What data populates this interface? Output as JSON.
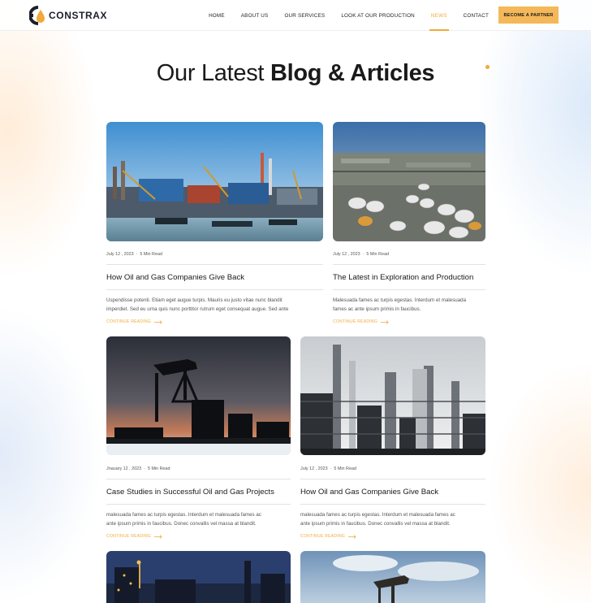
{
  "brand": {
    "name": "CONSTRAX"
  },
  "nav": {
    "items": [
      "HOME",
      "ABOUT US",
      "OUR SERVICES",
      "LOOK AT OUR PRODUCTION",
      "NEWS",
      "CONTACT"
    ],
    "active": "NEWS",
    "cta": "BECOME A PARTNER"
  },
  "section": {
    "title_light": "Our Latest",
    "title_bold": "Blog & Articles"
  },
  "posts": [
    {
      "date": "July 12 , 2023",
      "read_time": "5 Min Read",
      "title": "How Oil and Gas Companies Give Back",
      "excerpt_lines": [
        "Uspendisse potenti. Etiam eget augue turpis. Mauris eu justo vitae nunc blandit",
        "imperdiet. Sed eu urna quis nunc porttitor rutrum eget consequat augue. Sed ante"
      ],
      "link": "CONTINUE READING",
      "image": "industrial-port-image"
    },
    {
      "date": "July 12 , 2023",
      "read_time": "5 Min Read",
      "title": "The Latest in Exploration and Production",
      "excerpt_lines": [
        "Malesuada fames ac turpis egestas. Interdum et malesuada",
        "fames ac ante ipsum primis in faucibus."
      ],
      "link": "CONTINUE READING",
      "image": "oil-storage-tanks-image"
    },
    {
      "date": "Jnauary 12 , 2023",
      "read_time": "5 Min Read",
      "title": "Case Studies in Successful Oil and Gas Projects",
      "excerpt_lines": [
        "malesuada fames ac turpis egestas. Interdum et malesuada fames ac",
        "ante ipsum primis in faucibus. Donec convallis vel massa at blandit."
      ],
      "link": "CONTINUE READING",
      "image": "pumpjack-sunset-image"
    },
    {
      "date": "July 12 , 2023",
      "read_time": "5 Min Read",
      "title": "How Oil and Gas Companies Give Back",
      "excerpt_lines": [
        "malesuada fames ac turpis egestas. Interdum et malesuada fames ac",
        "ante ipsum primis in faucibus. Donec convallis vel massa at blandit."
      ],
      "link": "CONTINUE READING",
      "image": "refinery-columns-image"
    },
    {
      "image": "refinery-night-image"
    },
    {
      "image": "pumpjack-sky-image"
    }
  ],
  "colors": {
    "accent": "#f0a93b",
    "cta_bg": "#f4b85a",
    "text": "#1a1a1a",
    "muted": "#555555",
    "rule": "#e3e3e3"
  },
  "icons": [
    "constrax-logo-icon",
    "arrow-right-icon"
  ]
}
